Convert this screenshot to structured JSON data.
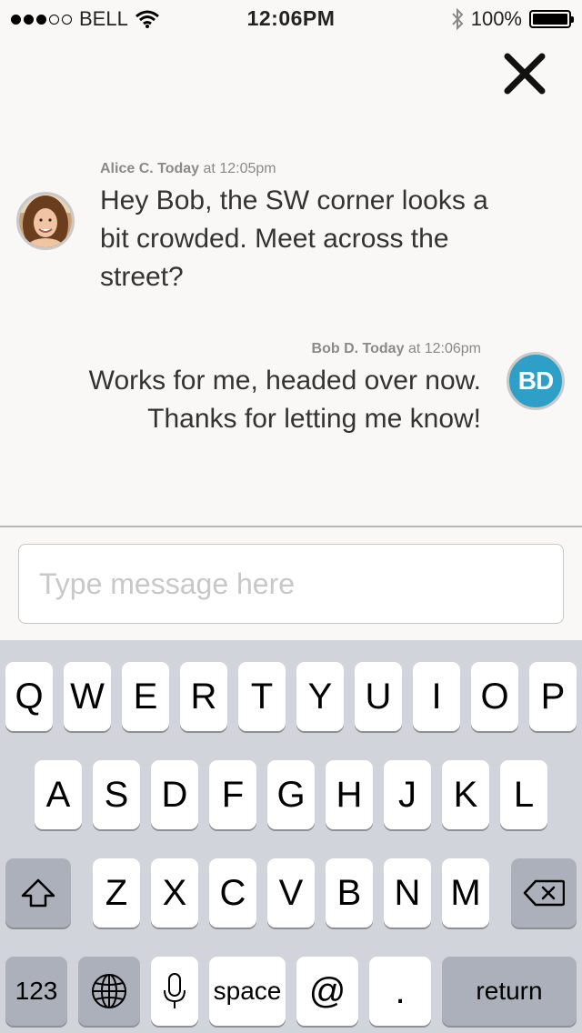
{
  "status_bar": {
    "carrier": "BELL",
    "time": "12:06PM",
    "battery": "100%",
    "signal_strength": 3,
    "signal_max": 5,
    "battery_level": 1.0
  },
  "messages": [
    {
      "sender": "Alice C.",
      "day": "Today",
      "time": "at 12:05pm",
      "lines": [
        "Hey Bob, the SW corner looks a",
        "bit crowded. Meet across the",
        "street?"
      ]
    },
    {
      "sender": "Bob D.",
      "day": "Today",
      "time": "at 12:06pm",
      "initials": "BD",
      "lines": [
        "Works for me, headed over now.",
        "Thanks for letting me know!"
      ]
    }
  ],
  "composer": {
    "placeholder": "Type message here",
    "value": ""
  },
  "keyboard": {
    "row1": [
      "Q",
      "W",
      "E",
      "R",
      "T",
      "Y",
      "U",
      "I",
      "O",
      "P"
    ],
    "row2": [
      "A",
      "S",
      "D",
      "F",
      "G",
      "H",
      "J",
      "K",
      "L"
    ],
    "row3": [
      "Z",
      "X",
      "C",
      "V",
      "B",
      "N",
      "M"
    ],
    "numbers_key": "123",
    "space_key": "space",
    "at_key": "@",
    "period_key": ".",
    "return_key": "return"
  },
  "colors": {
    "avatar_bd": "#2e9fc6",
    "background": "#f9f8f6",
    "keyboard": "#d1d5db"
  },
  "icons": [
    "wifi-icon",
    "bluetooth-icon",
    "battery-icon",
    "close-icon",
    "shift-icon",
    "backspace-icon",
    "globe-icon",
    "microphone-icon"
  ]
}
